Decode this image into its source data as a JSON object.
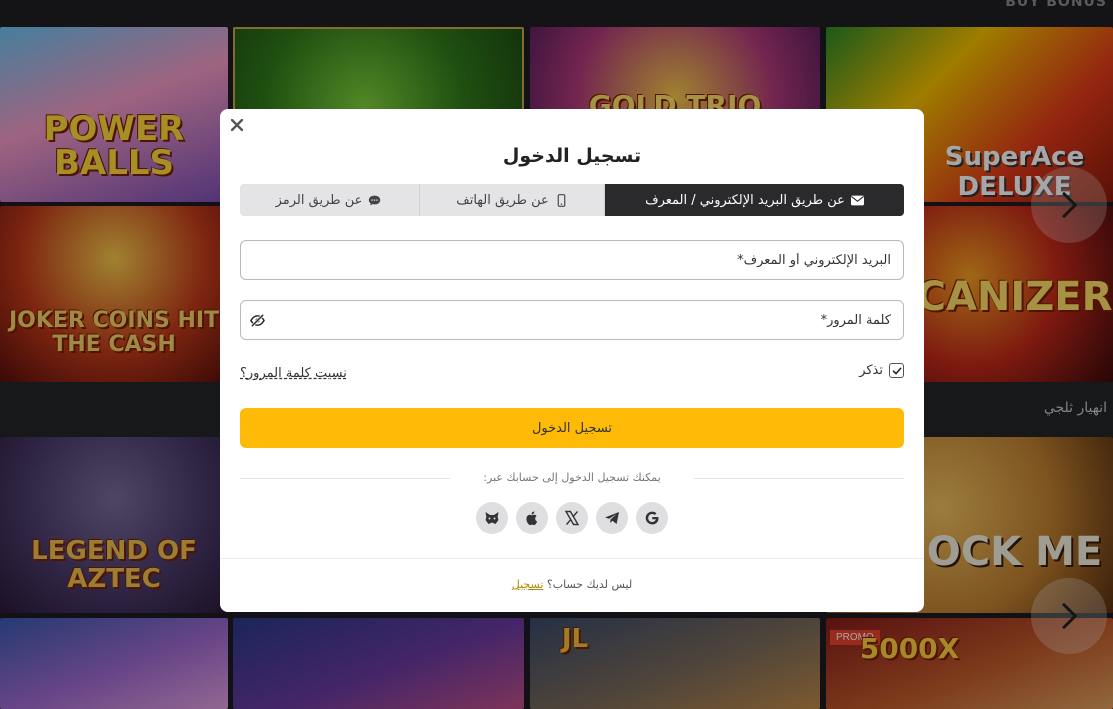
{
  "background": {
    "top_label": "BUY BONUS",
    "row_label": "انهيار ثلجي",
    "promo_badge": "PROMO",
    "tiles": [
      {
        "name": "tile-power-balls",
        "title": "POWER BALLS"
      },
      {
        "name": "tile-clover",
        "title": ""
      },
      {
        "name": "tile-gold-trio",
        "title": "GOLD TRIO"
      },
      {
        "name": "tile-super-ace",
        "title": "SuperAce DELUXE"
      },
      {
        "name": "tile-joker-coins",
        "title": "JOKER COINS HIT THE CASH"
      },
      {
        "name": "tile-volcanizer",
        "title": "CANIZER"
      },
      {
        "name": "tile-legend-aztec",
        "title": "LEGEND OF AZTEC"
      },
      {
        "name": "tile-rock-me",
        "title": "OCK ME"
      },
      {
        "name": "tile-fairy",
        "title": ""
      },
      {
        "name": "tile-jester",
        "title": ""
      },
      {
        "name": "tile-pirate",
        "title": "JL"
      },
      {
        "name": "tile-5000x",
        "title": "5000X"
      }
    ]
  },
  "modal": {
    "close_icon": "close-icon",
    "title": "تسجيل الدخول",
    "tabs": [
      {
        "label": "عن طريق البريد الإلكتروني / المعرف",
        "icon": "envelope-icon",
        "active": true
      },
      {
        "label": "عن طريق الهاتف",
        "icon": "phone-icon",
        "active": false
      },
      {
        "label": "عن طريق الرمز",
        "icon": "chat-icon",
        "active": false
      }
    ],
    "email_placeholder": "البريد الإلكتروني أو المعرف*",
    "password_placeholder": "كلمة المرور*",
    "remember_label": "تذكر",
    "remember_checked": true,
    "forgot_label": "نسيت كلمة المرور؟",
    "login_label": "تسجيل الدخول",
    "social_text": "يمكنك تسجيل الدخول إلى حسابك عبر:",
    "socials": [
      "google-icon",
      "telegram-icon",
      "x-icon",
      "apple-icon",
      "metamask-icon"
    ],
    "no_account_text": "ليس لديك حساب؟",
    "register_label": "تسجيل"
  },
  "colors": {
    "accent": "#ffba08",
    "active_tab": "#2a2a2d",
    "link": "#b08a00"
  }
}
